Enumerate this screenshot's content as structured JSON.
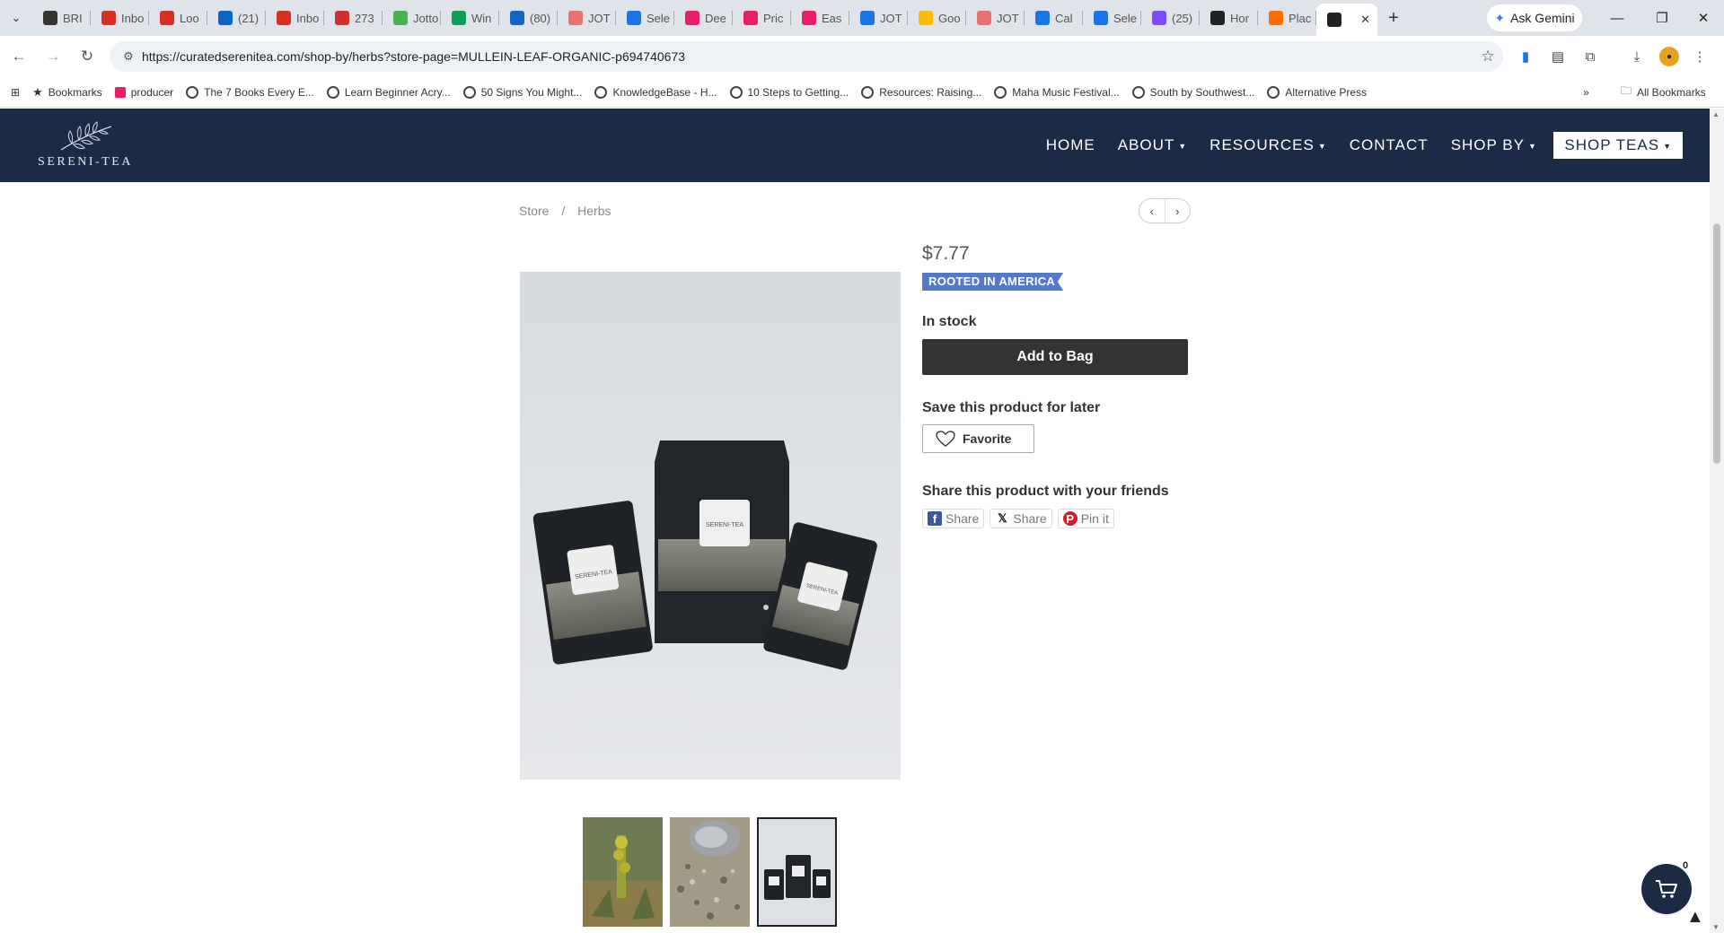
{
  "browser": {
    "tabs": [
      {
        "label": "BRI",
        "icon": "bag-icon",
        "color": "#333333"
      },
      {
        "label": "Inbo",
        "icon": "gmail-icon",
        "color": "#d93025"
      },
      {
        "label": "Loo",
        "icon": "gmail-icon",
        "color": "#d93025"
      },
      {
        "label": "(21)",
        "icon": "linkedin-icon",
        "color": "#0a66c2"
      },
      {
        "label": "Inbo",
        "icon": "gmail-icon",
        "color": "#d93025"
      },
      {
        "label": "273",
        "icon": "home-icon",
        "color": "#d32f2f"
      },
      {
        "label": "Jotto",
        "icon": "pin-icon",
        "color": "#4caf50"
      },
      {
        "label": "Win",
        "icon": "chart-icon",
        "color": "#0f9d58"
      },
      {
        "label": "(80)",
        "icon": "meta-icon",
        "color": "#1565c0"
      },
      {
        "label": "JOT",
        "icon": "jot-icon",
        "color": "#e57373"
      },
      {
        "label": "Sele",
        "icon": "globe-icon",
        "color": "#1a73e8"
      },
      {
        "label": "Dee",
        "icon": "deel-icon",
        "color": "#e91e63"
      },
      {
        "label": "Pric",
        "icon": "j-icon",
        "color": "#e91e63"
      },
      {
        "label": "Eas",
        "icon": "j-icon",
        "color": "#e91e63"
      },
      {
        "label": "JOT",
        "icon": "calendar-icon",
        "color": "#1a73e8"
      },
      {
        "label": "Goo",
        "icon": "meet-icon",
        "color": "#fbbc04"
      },
      {
        "label": "JOT",
        "icon": "jot-icon",
        "color": "#e57373"
      },
      {
        "label": "Cal",
        "icon": "globe-icon",
        "color": "#1a73e8"
      },
      {
        "label": "Sele",
        "icon": "globe-icon",
        "color": "#1a73e8"
      },
      {
        "label": "(25)",
        "icon": "mail-icon",
        "color": "#7c4dff"
      },
      {
        "label": "Hor",
        "icon": "square-icon",
        "color": "#222222"
      },
      {
        "label": "Plac",
        "icon": "orange-icon",
        "color": "#ff6d00"
      },
      {
        "label": "",
        "icon": "site-icon",
        "color": "#222222",
        "active": true
      }
    ],
    "gemini_label": "Ask Gemini",
    "url": "https://curatedserenitea.com/shop-by/herbs?store-page=MULLEIN-LEAF-ORGANIC-p694740673",
    "bookmarks": [
      {
        "label": "Bookmarks",
        "icon": "star-icon"
      },
      {
        "label": "producer",
        "icon": "deel-icon"
      },
      {
        "label": "The 7 Books Every E...",
        "icon": "globe-icon"
      },
      {
        "label": "Learn Beginner Acry...",
        "icon": "globe-icon"
      },
      {
        "label": "50 Signs You Might...",
        "icon": "globe-icon"
      },
      {
        "label": "KnowledgeBase - H...",
        "icon": "globe-icon"
      },
      {
        "label": "10 Steps to Getting...",
        "icon": "globe-icon"
      },
      {
        "label": "Resources: Raising...",
        "icon": "globe-icon"
      },
      {
        "label": "Maha Music Festival...",
        "icon": "globe-icon"
      },
      {
        "label": "South by Southwest...",
        "icon": "globe-icon"
      },
      {
        "label": "Alternative Press",
        "icon": "globe-icon"
      }
    ],
    "all_bookmarks": "All Bookmarks",
    "overflow": "»"
  },
  "site": {
    "logo_text": "SERENI-TEA",
    "nav": [
      {
        "label": "HOME",
        "dropdown": false
      },
      {
        "label": "ABOUT",
        "dropdown": true
      },
      {
        "label": "RESOURCES",
        "dropdown": true
      },
      {
        "label": "CONTACT",
        "dropdown": false
      },
      {
        "label": "SHOP BY",
        "dropdown": true
      },
      {
        "label": "SHOP TEAS",
        "dropdown": true,
        "boxed": true
      }
    ]
  },
  "breadcrumb": {
    "store": "Store",
    "sep": "/",
    "current": "Herbs"
  },
  "product": {
    "price": "$7.77",
    "badge": "ROOTED IN AMERICA",
    "stock": "In stock",
    "add_to_bag": "Add to Bag",
    "save_label": "Save this product for later",
    "favorite": "Favorite",
    "share_label": "Share this product with your friends",
    "share_buttons": [
      {
        "label": "Share",
        "icon": "facebook-icon",
        "color": "#3b5998"
      },
      {
        "label": "Share",
        "icon": "x-icon",
        "color": "#111111"
      },
      {
        "label": "Pin it",
        "icon": "pinterest-icon",
        "color": "#cb2027"
      }
    ],
    "bag_labels": [
      "SERENI-TEA",
      "SERENI-TEA",
      "SERENI-TEA"
    ],
    "thumbnails": [
      {
        "name": "mullein-plant-thumbnail",
        "selected": false
      },
      {
        "name": "dried-leaf-thumbnail",
        "selected": false
      },
      {
        "name": "packaging-thumbnail",
        "selected": true
      }
    ]
  },
  "cart": {
    "count": "0"
  },
  "colors": {
    "header_bg": "#1b2a45",
    "badge": "#5479c7",
    "button": "#333333"
  }
}
